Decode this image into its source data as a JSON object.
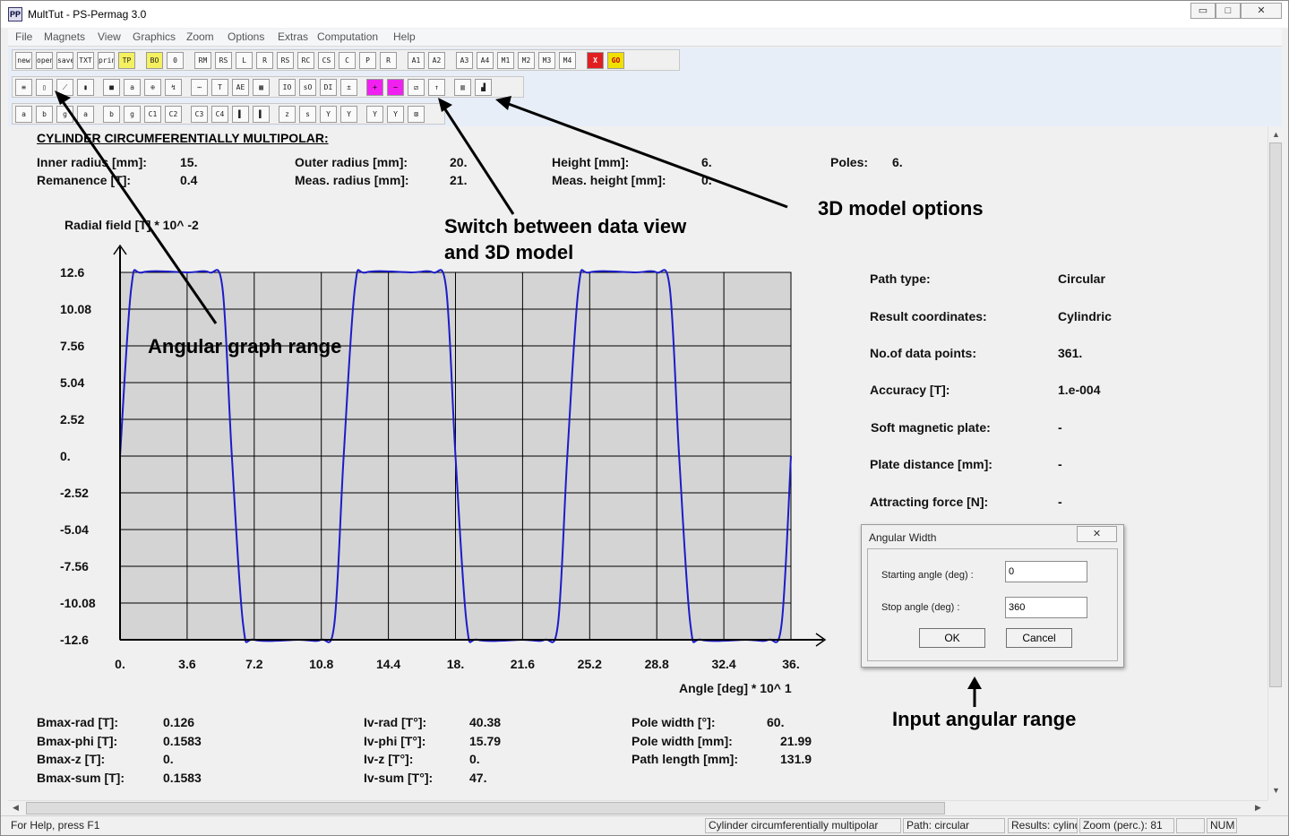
{
  "window": {
    "title": "MultTut - PS-Permag 3.0",
    "app_icon": "PP"
  },
  "window_buttons": {
    "minimize": "▭",
    "maximize": "□",
    "close": "✕"
  },
  "menu": [
    "File",
    "Magnets",
    "View",
    "Graphics",
    "Zoom",
    "Options",
    "Extras",
    "Computation",
    "Help"
  ],
  "toolbar": {
    "row1": [
      "new",
      "open",
      "save",
      "TXT",
      "print",
      "TP",
      "BO",
      "0",
      "RM",
      "RS",
      "L",
      "R",
      "RS",
      "RC",
      "CS",
      "C",
      "P",
      "R",
      "A1",
      "A2",
      "A3",
      "A4",
      "M1",
      "M2",
      "M3",
      "M4",
      "X",
      "GO"
    ],
    "row2": [
      "≡",
      "▯",
      "⟋",
      "▮",
      "■",
      "a",
      "⊕",
      "↯",
      "⋯",
      "T",
      "AE",
      "▦",
      "IO",
      "sO",
      "DI",
      "±",
      "+",
      "−",
      "⧄",
      "↑",
      "▥",
      "▟"
    ],
    "row3": [
      "a",
      "b",
      "g",
      "a",
      "b",
      "g",
      "C1",
      "C2",
      "C3",
      "C4",
      "▌",
      "▌",
      "z",
      "s",
      "Y",
      "Y",
      "Y",
      "Y",
      "⊠"
    ]
  },
  "magnet": {
    "title": "CYLINDER CIRCUMFERENTIALLY MULTIPOLAR:",
    "inner_radius_label": "Inner radius [mm]:",
    "inner_radius": "15.",
    "remanence_label": "Remanence [T]:",
    "remanence": "0.4",
    "outer_radius_label": "Outer radius [mm]:",
    "outer_radius": "20.",
    "meas_radius_label": "Meas. radius [mm]:",
    "meas_radius": "21.",
    "height_label": "Height [mm]:",
    "height": "6.",
    "meas_height_label": "Meas. height [mm]:",
    "meas_height": "0.",
    "poles_label": "Poles:",
    "poles": "6."
  },
  "chart_data": {
    "type": "line",
    "ylabel": "Radial field [T] * 10^ -2",
    "xlabel": "Angle [deg] * 10^ 1",
    "x_ticks": [
      "0.",
      "3.6",
      "7.2",
      "10.8",
      "14.4",
      "18.",
      "21.6",
      "25.2",
      "28.8",
      "32.4",
      "36."
    ],
    "y_ticks": [
      "12.6",
      "10.08",
      "7.56",
      "5.04",
      "2.52",
      "0.",
      "-2.52",
      "-5.04",
      "-7.56",
      "-10.08",
      "-12.6"
    ],
    "xlim": [
      0,
      36
    ],
    "ylim": [
      -12.6,
      12.6
    ],
    "grid": true,
    "background": "#d4d4d4",
    "line_color": "#1c1cc8",
    "series": [
      {
        "x": [
          0,
          0.6,
          1.2,
          3.6,
          4.8,
          5.5,
          6.0,
          6.6,
          7.2,
          9.6,
          10.8,
          11.5,
          12.0,
          12.6,
          13.2,
          15.6,
          16.8,
          17.5,
          18.0,
          18.6,
          19.2,
          21.6,
          22.8,
          23.5,
          24.0,
          24.6,
          25.2,
          27.6,
          28.8,
          29.5,
          30.0,
          30.6,
          31.2,
          33.6,
          34.8,
          35.5,
          36.0
        ],
        "y": [
          0,
          11.5,
          12.6,
          12.6,
          12.6,
          11.5,
          0,
          -11.5,
          -12.6,
          -12.6,
          -12.6,
          -11.5,
          0,
          11.5,
          12.6,
          12.6,
          12.6,
          11.5,
          0,
          -11.5,
          -12.6,
          -12.6,
          -12.6,
          -11.5,
          0,
          11.5,
          12.6,
          12.6,
          12.6,
          11.5,
          0,
          -11.5,
          -12.6,
          -12.6,
          -12.6,
          -11.5,
          0
        ]
      }
    ]
  },
  "path_info": {
    "path_type_label": "Path type:",
    "path_type": "Circular",
    "result_coords_label": "Result coordinates:",
    "result_coords": "Cylindric",
    "data_points_label": "No.of data points:",
    "data_points": "361.",
    "accuracy_label": "Accuracy [T]:",
    "accuracy": "1.e-004",
    "soft_plate_label": "Soft magnetic plate:",
    "soft_plate": "-",
    "plate_distance_label": "Plate distance [mm]:",
    "plate_distance": "-",
    "attracting_force_label": "Attracting force [N]:",
    "attracting_force": "-"
  },
  "results": {
    "bmax_rad_label": "Bmax-rad [T]:",
    "bmax_rad": "0.126",
    "bmax_phi_label": "Bmax-phi [T]:",
    "bmax_phi": "0.1583",
    "bmax_z_label": "Bmax-z [T]:",
    "bmax_z": "0.",
    "bmax_sum_label": "Bmax-sum [T]:",
    "bmax_sum": "0.1583",
    "iv_rad_label": "Iv-rad [T°]:",
    "iv_rad": "40.38",
    "iv_phi_label": "Iv-phi [T°]:",
    "iv_phi": "15.79",
    "iv_z_label": "Iv-z [T°]:",
    "iv_z": "0.",
    "iv_sum_label": "Iv-sum [T°]:",
    "iv_sum": "47.",
    "pole_width_deg_label": "Pole width [°]:",
    "pole_width_deg": "60.",
    "pole_width_mm_label": "Pole width [mm]:",
    "pole_width_mm": "21.99",
    "path_length_label": "Path length [mm]:",
    "path_length": "131.9"
  },
  "annotations": {
    "angular_graph_range": "Angular graph range",
    "switch_view_line1": "Switch between data view",
    "switch_view_line2": "and 3D model",
    "model_options": "3D model options",
    "input_range": "Input angular range"
  },
  "dialog": {
    "title": "Angular Width",
    "close": "✕",
    "start_label": "Starting angle (deg) :",
    "start_value": "0",
    "stop_label": "Stop angle (deg) :",
    "stop_value": "360",
    "ok": "OK",
    "cancel": "Cancel"
  },
  "statusbar": {
    "help": "For Help, press F1",
    "model": "Cylinder circumferentially multipolar",
    "path": "Path: circular",
    "results": "Results: cylindric",
    "zoom": "Zoom (perc.): 81",
    "blank": "",
    "num": "NUM"
  }
}
